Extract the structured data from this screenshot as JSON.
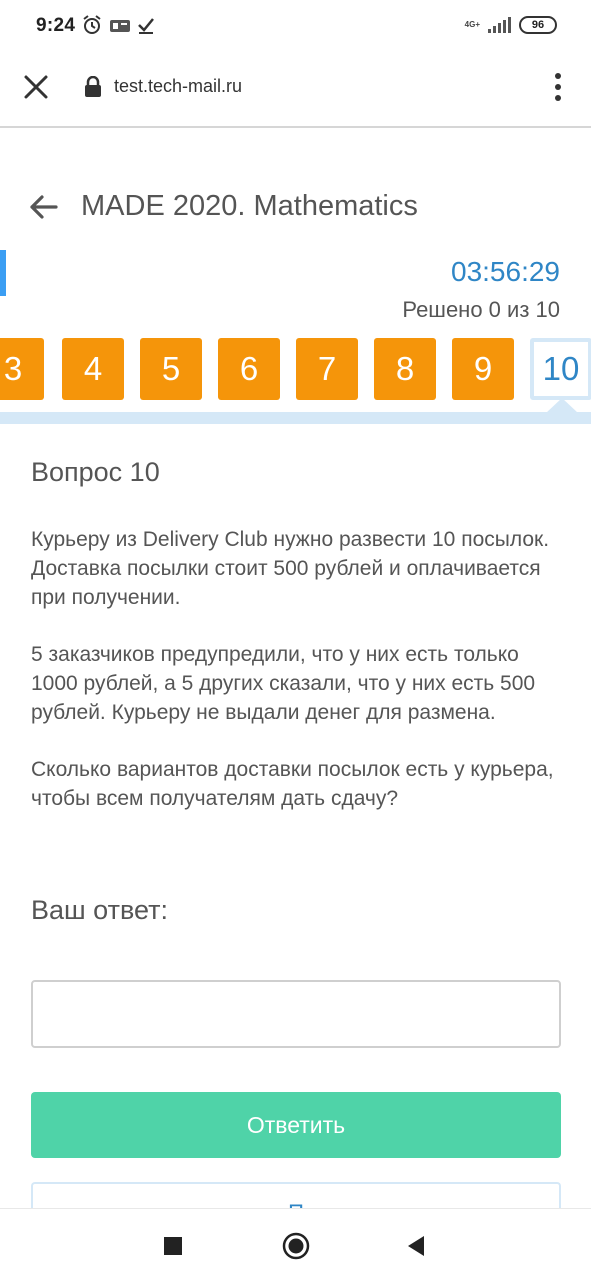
{
  "status_bar": {
    "time": "9:24",
    "network": "4G+",
    "battery": "96"
  },
  "browser": {
    "url": "test.tech-mail.ru"
  },
  "header": {
    "title": "MADE 2020. Mathematics"
  },
  "test": {
    "timer": "03:56:29",
    "solved": "Решено 0 из 10",
    "tiles": [
      "3",
      "4",
      "5",
      "6",
      "7",
      "8",
      "9",
      "10"
    ],
    "active_tile": "10"
  },
  "question": {
    "title": "Вопрос 10",
    "paragraph_1": "Курьеру из Delivery Club нужно развести 10 посылок. Доставка посылки стоит 500 рублей и оплачивается при получении.",
    "paragraph_2": "5 заказчиков предупредили, что у них есть только 1000 рублей, а 5 других сказали, что у них есть 500 рублей. Курьеру не выдали денег для размена.",
    "paragraph_3": "Сколько вариантов доставки посылок есть у курьера, чтобы всем получателям дать сдачу?"
  },
  "answer": {
    "label": "Ваш ответ:",
    "value": "",
    "submit_label": "Ответить",
    "second_label": "П"
  },
  "colors": {
    "tile": "#f5950a",
    "timer": "#2f86c6",
    "submit": "#4fd3a8",
    "accent": "#3b9ef3"
  }
}
